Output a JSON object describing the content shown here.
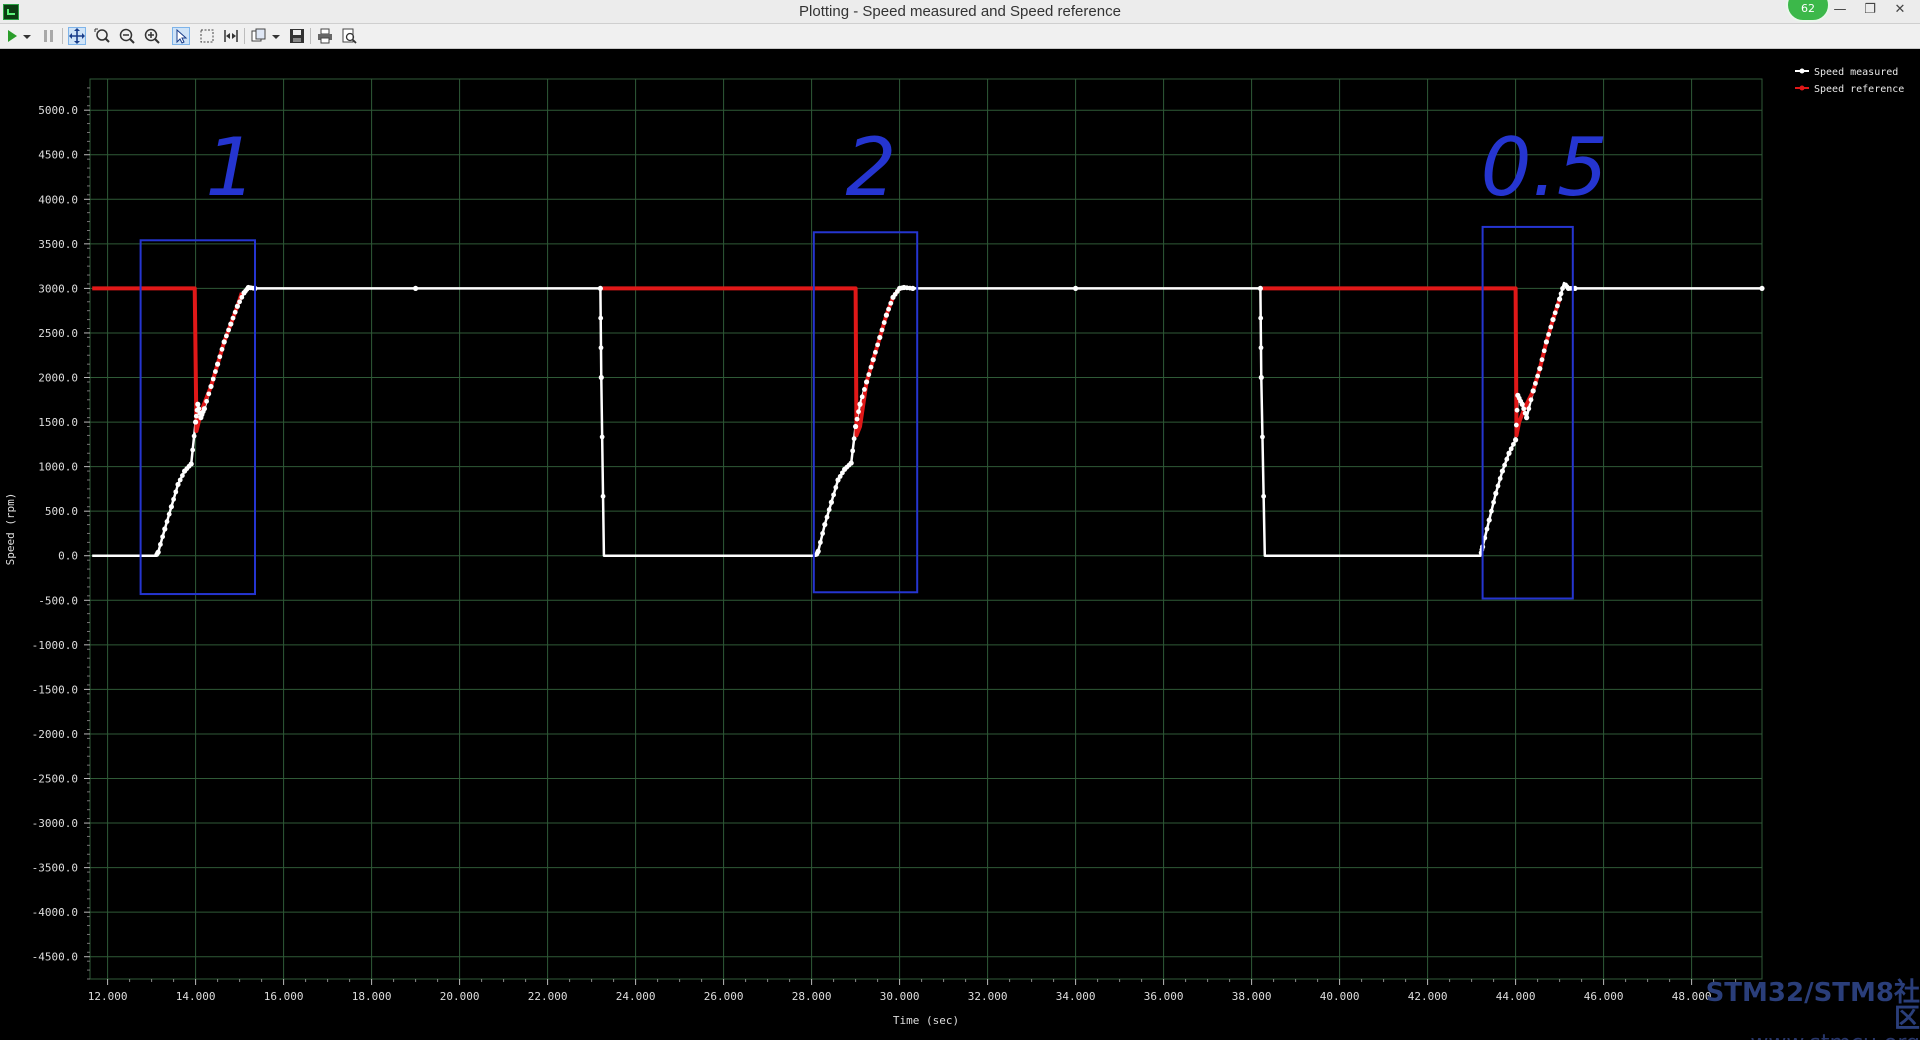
{
  "window": {
    "title": "Plotting  - Speed measured and Speed reference",
    "badge": "62",
    "minimize": "—",
    "restore": "❐",
    "close": "✕"
  },
  "toolbar": {
    "icons": [
      "play-icon",
      "dropdown-arrow-icon",
      "pause-icon",
      "pan-icon",
      "zoom-fit-icon",
      "zoom-out-icon",
      "zoom-in-icon",
      "select-arrow-icon",
      "selection-rect-icon",
      "measure-icon",
      "copy-icon",
      "dropdown-arrow-icon",
      "save-icon",
      "print-icon",
      "print-preview-icon"
    ]
  },
  "chart_data": {
    "type": "line",
    "title": "",
    "xlabel": "Time (sec)",
    "ylabel": "Speed (rpm)",
    "xlim": [
      11.6,
      49.6
    ],
    "ylim": [
      -4750,
      5350
    ],
    "xticks": [
      "12.000",
      "14.000",
      "16.000",
      "18.000",
      "20.000",
      "22.000",
      "24.000",
      "26.000",
      "28.000",
      "30.000",
      "32.000",
      "34.000",
      "36.000",
      "38.000",
      "40.000",
      "42.000",
      "44.000",
      "46.000",
      "48.000"
    ],
    "yticks": [
      "5000.0",
      "4500.0",
      "4000.0",
      "3500.0",
      "3000.0",
      "2500.0",
      "2000.0",
      "1500.0",
      "1000.0",
      "500.0",
      "0.0",
      "-500.0",
      "-1000.0",
      "-1500.0",
      "-2000.0",
      "-2500.0",
      "-3000.0",
      "-3500.0",
      "-4000.0",
      "-4500.0"
    ],
    "grid": true,
    "legend_position": "top-right",
    "background": "#000000",
    "grid_color": "#2f5a37",
    "series": [
      {
        "name": "Speed measured",
        "color": "#ffffff",
        "x": [
          11.65,
          13.1,
          13.15,
          13.3,
          13.45,
          13.6,
          13.75,
          13.9,
          14.0,
          14.05,
          14.12,
          14.2,
          14.35,
          14.5,
          14.65,
          14.8,
          14.95,
          15.1,
          15.2,
          15.35,
          19.0,
          23.2,
          23.22,
          23.28,
          28.1,
          28.15,
          28.3,
          28.45,
          28.6,
          28.75,
          28.9,
          29.0,
          29.1,
          29.25,
          29.4,
          29.55,
          29.7,
          29.85,
          30.0,
          30.1,
          30.3,
          34.0,
          38.2,
          38.22,
          38.3,
          43.2,
          43.25,
          43.4,
          43.55,
          43.7,
          43.85,
          44.0,
          44.05,
          44.15,
          44.25,
          44.4,
          44.55,
          44.7,
          44.85,
          45.0,
          45.1,
          45.2,
          45.35,
          49.6
        ],
        "y": [
          0,
          0,
          40,
          300,
          550,
          800,
          950,
          1030,
          1500,
          1700,
          1550,
          1650,
          1900,
          2150,
          2400,
          2600,
          2800,
          2950,
          3010,
          3000,
          3000,
          3000,
          2000,
          0,
          0,
          50,
          350,
          600,
          850,
          970,
          1040,
          1450,
          1700,
          1950,
          2200,
          2450,
          2700,
          2900,
          3000,
          3010,
          3000,
          3000,
          3000,
          2000,
          0,
          0,
          100,
          400,
          700,
          950,
          1150,
          1300,
          1800,
          1700,
          1550,
          1850,
          2100,
          2400,
          2650,
          2880,
          3060,
          3000,
          3000,
          3000
        ]
      },
      {
        "name": "Speed reference",
        "color": "#e01818",
        "segments": [
          {
            "x": [
              11.65,
              13.98,
              14.02,
              14.07,
              14.15,
              14.35,
              14.5,
              14.65,
              14.8,
              14.95,
              15.05
            ],
            "y": [
              3000,
              3000,
              1400,
              1500,
              1650,
              1900,
              2150,
              2400,
              2600,
              2800,
              2950
            ]
          },
          {
            "x": [
              23.25,
              29.0,
              29.02,
              29.1,
              29.25,
              29.4,
              29.55,
              29.7,
              29.85,
              30.0
            ],
            "y": [
              3000,
              3000,
              1350,
              1450,
              1950,
              2200,
              2450,
              2700,
              2900,
              3000
            ]
          },
          {
            "x": [
              38.25,
              44.0,
              44.02,
              44.08,
              44.2,
              44.4,
              44.55,
              44.7,
              44.85,
              45.0
            ],
            "y": [
              3000,
              3000,
              1350,
              1500,
              1650,
              1850,
              2100,
              2400,
              2650,
              2880
            ]
          }
        ]
      }
    ],
    "annotations": {
      "color": "#2535d0",
      "boxes": [
        {
          "x": [
            12.75,
            15.35
          ],
          "y": [
            -430,
            3540
          ]
        },
        {
          "x": [
            28.05,
            30.4
          ],
          "y": [
            -410,
            3630
          ]
        },
        {
          "x": [
            43.25,
            45.3
          ],
          "y": [
            -480,
            3690
          ]
        }
      ],
      "labels": [
        {
          "text": "1",
          "x": 14.8,
          "y": 4050
        },
        {
          "text": "2",
          "x": 29.35,
          "y": 4050
        },
        {
          "text": "0.5",
          "x": 44.65,
          "y": 4050
        }
      ]
    }
  },
  "watermark": {
    "line1": "STM32/STM8社区",
    "line2": "www.stmcu.org"
  }
}
